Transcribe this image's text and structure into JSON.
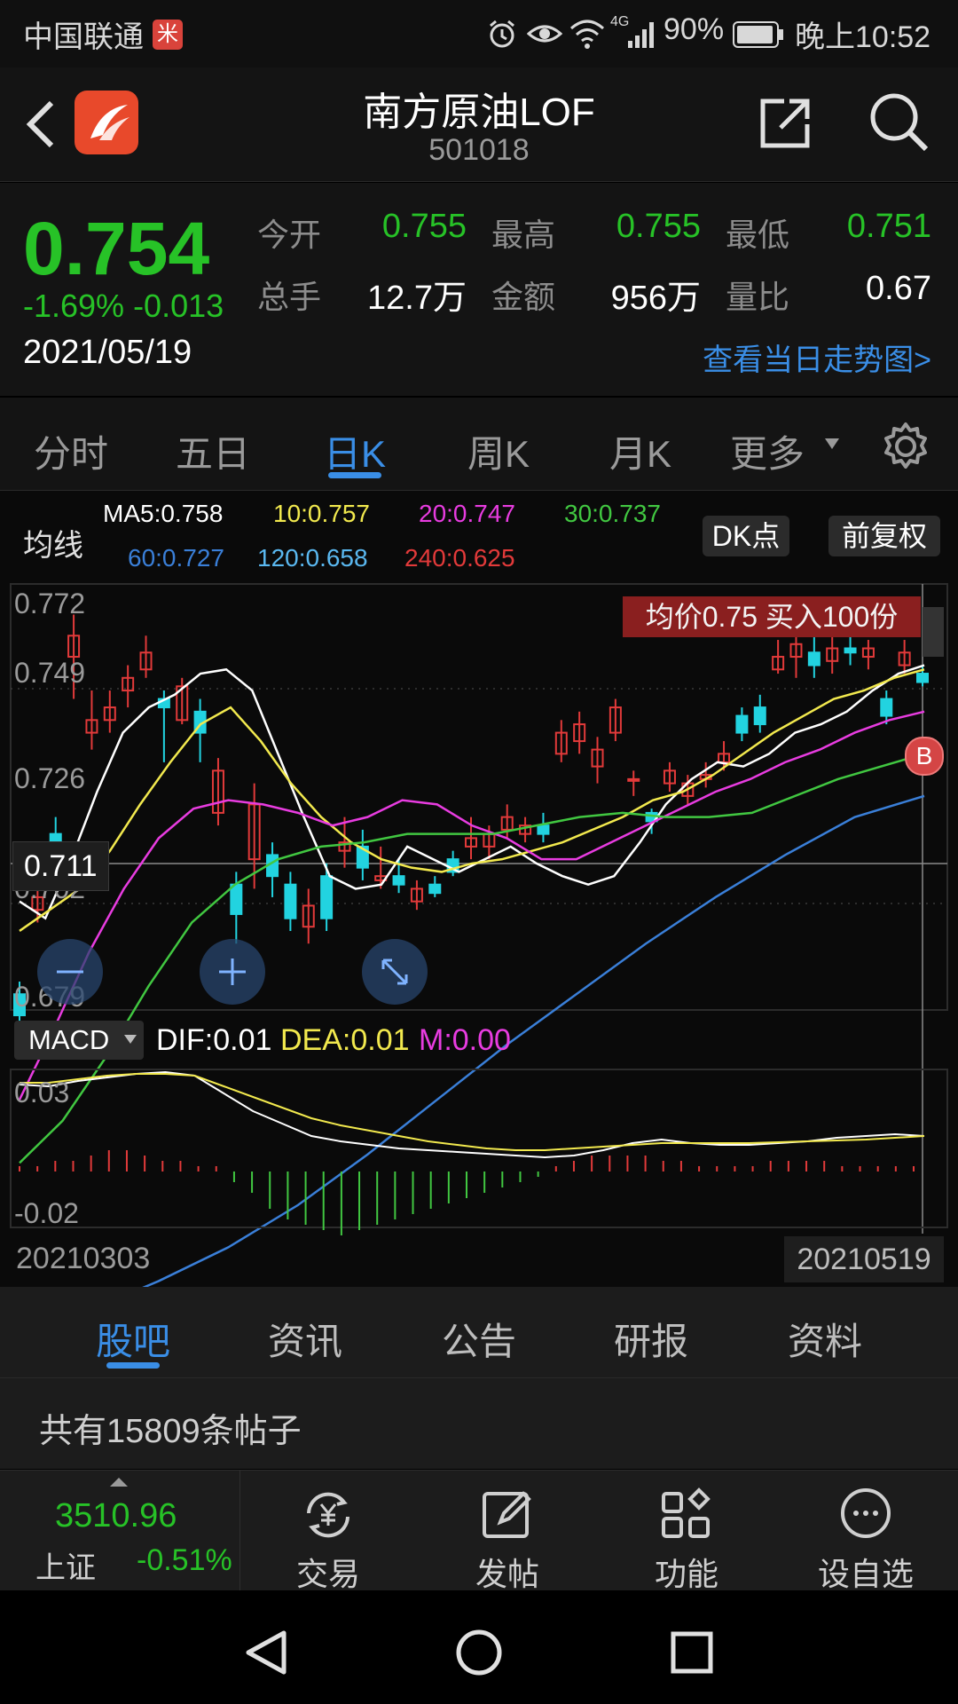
{
  "status": {
    "carrier": "中国联通",
    "carrier_badge": "米",
    "battery": "90%",
    "network": "4G",
    "time": "晚上10:52"
  },
  "header": {
    "title": "南方原油LOF",
    "code": "501018",
    "icons": [
      "back-icon",
      "app-logo",
      "share-icon",
      "search-icon"
    ]
  },
  "quote": {
    "price": "0.754",
    "change": "-1.69% -0.013",
    "date": "2021/05/19",
    "fields": [
      {
        "label": "今开",
        "value": "0.755",
        "color": "#27c227"
      },
      {
        "label": "最高",
        "value": "0.755",
        "color": "#27c227"
      },
      {
        "label": "最低",
        "value": "0.751",
        "color": "#27c227"
      },
      {
        "label": "总手",
        "value": "12.7万",
        "color": "#ffffff"
      },
      {
        "label": "金额",
        "value": "956万",
        "color": "#ffffff"
      },
      {
        "label": "量比",
        "value": "0.67",
        "color": "#ffffff"
      }
    ],
    "trend_link": "查看当日走势图>"
  },
  "tabs": [
    "分时",
    "五日",
    "日K",
    "周K",
    "月K",
    "更多"
  ],
  "active_tab": "日K",
  "ma": {
    "title": "均线",
    "items": [
      {
        "text": "MA5:0.758",
        "color": "#ffffff"
      },
      {
        "text": "10:0.757",
        "color": "#f2e94e"
      },
      {
        "text": "20:0.747",
        "color": "#e83ce0"
      },
      {
        "text": "30:0.737",
        "color": "#41c741"
      },
      {
        "text": "60:0.727",
        "color": "#3a7fd8"
      },
      {
        "text": "120:0.658",
        "color": "#5ab8f0"
      },
      {
        "text": "240:0.625",
        "color": "#e23a3a"
      }
    ],
    "btn_dk": "DK点",
    "btn_restore": "前复权"
  },
  "kchart": {
    "y_labels": [
      "0.772",
      "0.749",
      "0.726",
      "0.702",
      "0.679"
    ],
    "crosshair_price": "0.711",
    "avg_banner": "均价0.75  买入100份",
    "marker": "B"
  },
  "macd": {
    "selector": "MACD",
    "dif": "DIF:0.01",
    "dea": "DEA:0.01",
    "m": "M:0.00",
    "y_labels": [
      "0.03",
      "-0.02"
    ]
  },
  "dates": {
    "start": "20210303",
    "end": "20210519"
  },
  "bottom_tabs": [
    "股吧",
    "资讯",
    "公告",
    "研报",
    "资料"
  ],
  "posts_count": "共有15809条帖子",
  "index": {
    "value": "3510.96",
    "name": "上证",
    "change": "-0.51%"
  },
  "bottom_actions": [
    "交易",
    "发帖",
    "功能",
    "设自选"
  ],
  "colors": {
    "up": "#e23a3a",
    "down": "#22d3e0",
    "green": "#27c227",
    "accent": "#3a8ee6"
  }
}
